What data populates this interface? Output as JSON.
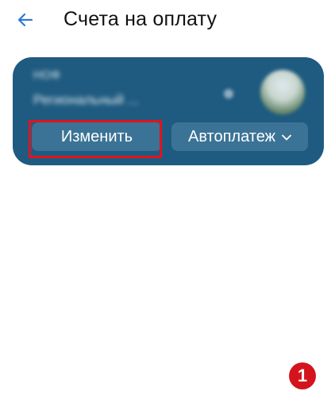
{
  "header": {
    "title": "Счета на оплату",
    "back_icon": "arrow-left-icon"
  },
  "account_card": {
    "name_line": "НОФ",
    "subtitle_line": "Региональный ...",
    "avatar_icon": "account-avatar",
    "edit_label": "Изменить",
    "autopay_label": "Автоплатеж",
    "autopay_icon": "chevron-down-icon"
  },
  "annotation": {
    "step_number": "1",
    "highlight_color": "#e0141e"
  },
  "colors": {
    "card_bg": "#1f5b80",
    "button_bg": "#3b7396",
    "accent": "#2e79d6"
  }
}
